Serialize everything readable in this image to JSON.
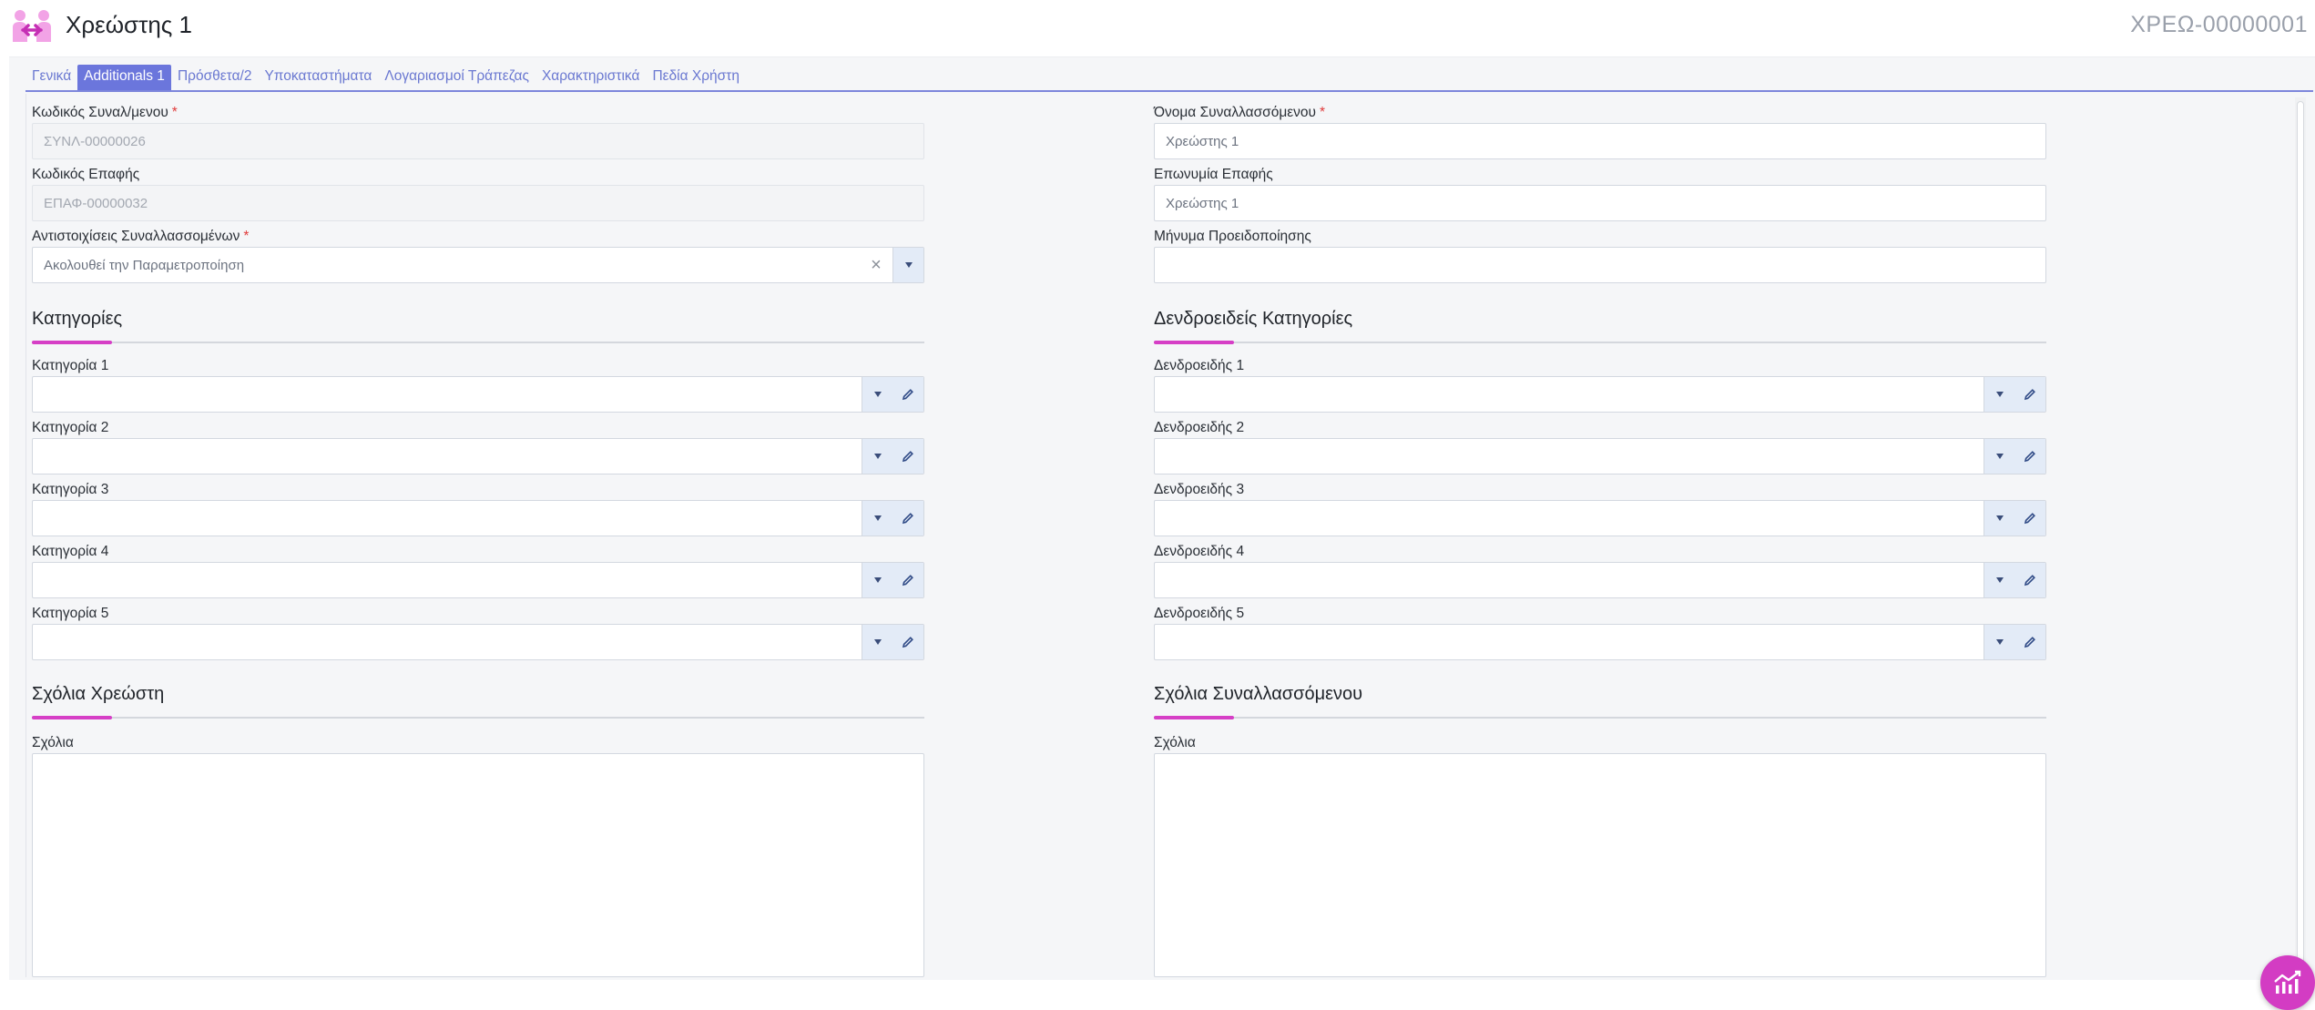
{
  "header": {
    "title": "Χρεώστης 1",
    "record_code": "ΧΡΕΩ-00000001"
  },
  "tabs": [
    {
      "label": "Γενικά",
      "active": false
    },
    {
      "label": "Additionals 1",
      "active": true
    },
    {
      "label": "Πρόσθετα/2",
      "active": false
    },
    {
      "label": "Υποκαταστήματα",
      "active": false
    },
    {
      "label": "Λογαριασμοί Τράπεζας",
      "active": false
    },
    {
      "label": "Χαρακτηριστικά",
      "active": false
    },
    {
      "label": "Πεδία Χρήστη",
      "active": false
    }
  ],
  "left": {
    "code": {
      "label": "Κωδικός Συναλ/μενου",
      "value": "ΣΥΝΛ-00000026"
    },
    "contact_code": {
      "label": "Κωδικός Επαφής",
      "value": "ΕΠΑΦ-00000032"
    },
    "mappings": {
      "label": "Αντιστοιχίσεις Συναλλασσομένων",
      "value": "Ακολουθεί την Παραμετροποίηση"
    },
    "categories_title": "Κατηγορίες",
    "categories": [
      {
        "label": "Κατηγορία 1",
        "value": ""
      },
      {
        "label": "Κατηγορία 2",
        "value": ""
      },
      {
        "label": "Κατηγορία 3",
        "value": ""
      },
      {
        "label": "Κατηγορία 4",
        "value": ""
      },
      {
        "label": "Κατηγορία 5",
        "value": ""
      }
    ],
    "comments_title": "Σχόλια Χρεώστη",
    "comments_label": "Σχόλια",
    "comments_value": ""
  },
  "right": {
    "name": {
      "label": "Όνομα Συναλλασσόμενου",
      "value": "Χρεώστης 1"
    },
    "contact_name": {
      "label": "Επωνυμία Επαφής",
      "value": "Χρεώστης 1"
    },
    "warning": {
      "label": "Μήνυμα Προειδοποίησης",
      "value": ""
    },
    "trees_title": "Δενδροειδείς Κατηγορίες",
    "trees": [
      {
        "label": "Δενδροειδής 1",
        "value": ""
      },
      {
        "label": "Δενδροειδής 2",
        "value": ""
      },
      {
        "label": "Δενδροειδής 3",
        "value": ""
      },
      {
        "label": "Δενδροειδής 4",
        "value": ""
      },
      {
        "label": "Δενδροειδής 5",
        "value": ""
      }
    ],
    "comments_title": "Σχόλια Συναλλασσόμενου",
    "comments_label": "Σχόλια",
    "comments_value": ""
  },
  "icons": {
    "logo": "handshake-logo-icon",
    "dropdown": "chevron-down-icon",
    "edit": "pencil-icon",
    "clear": "close-icon",
    "fab": "analytics-chart-icon"
  },
  "colors": {
    "accent": "#d63fc6",
    "tab_active": "#6b76dc",
    "required": "#e03b3b"
  }
}
